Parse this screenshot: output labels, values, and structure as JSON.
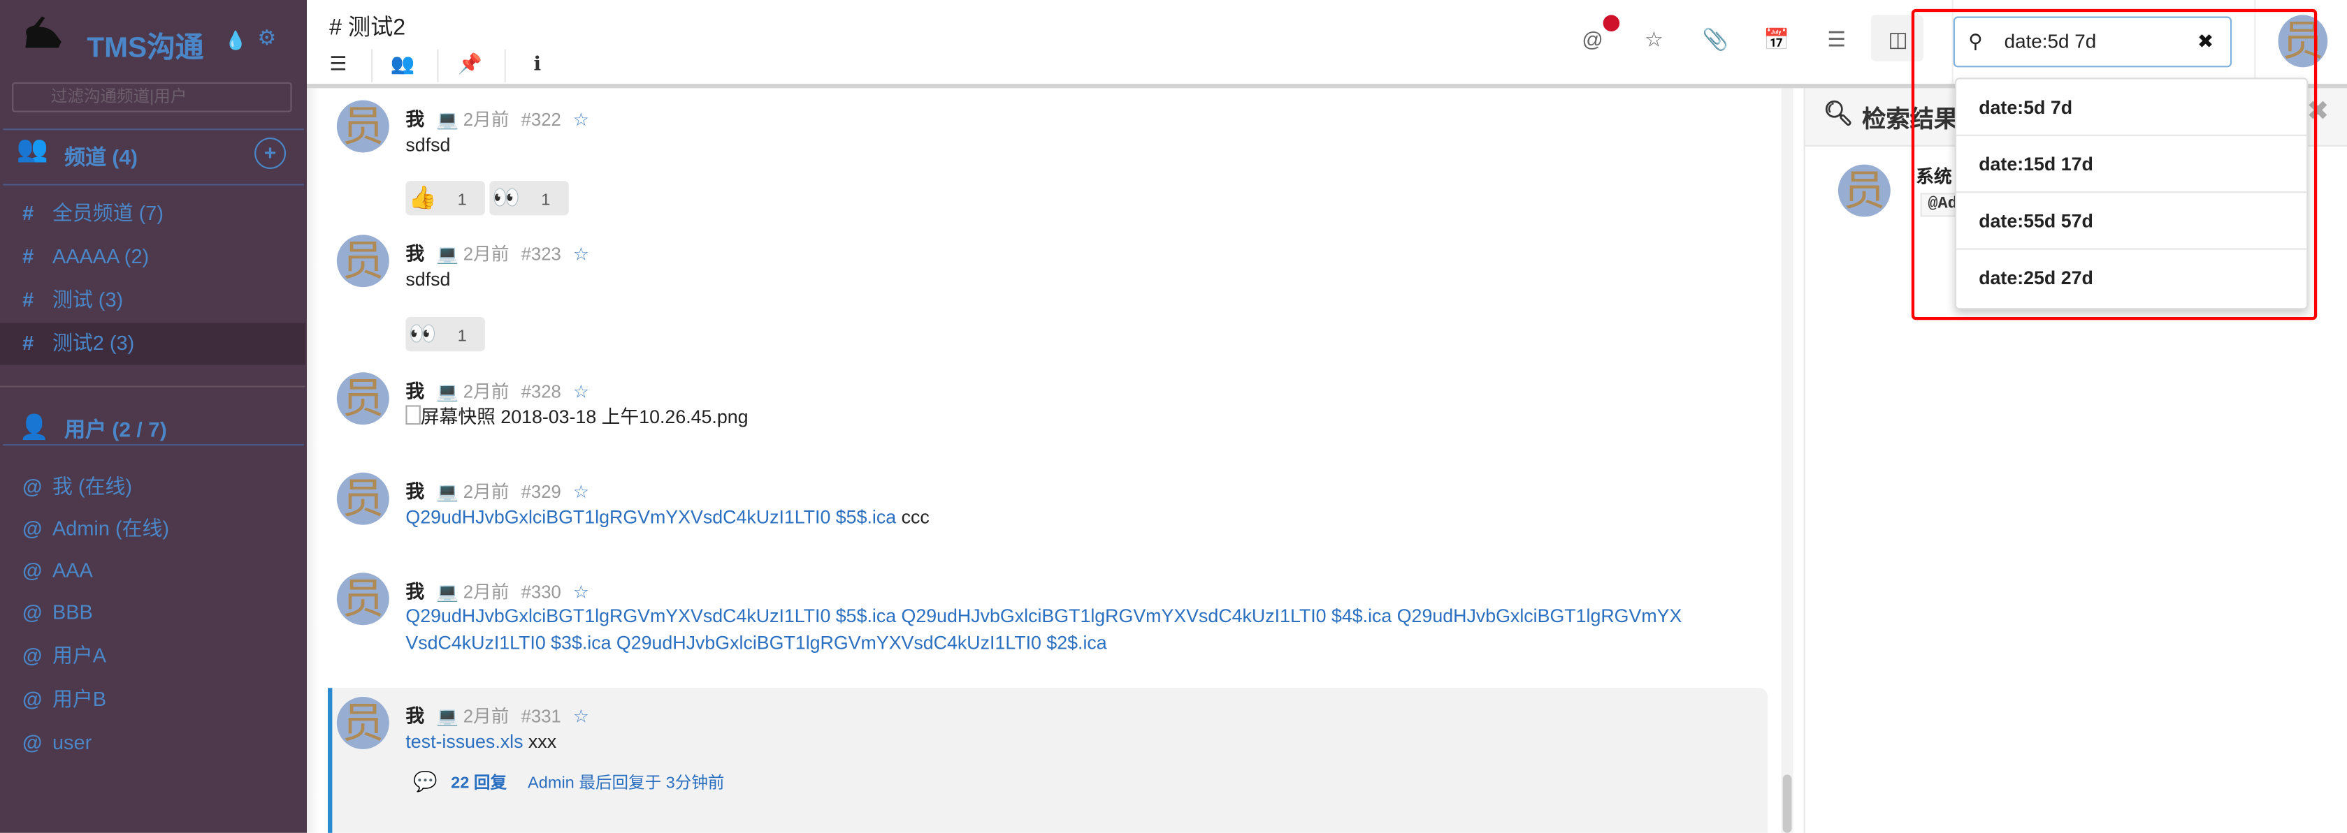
{
  "sidebar": {
    "app_title": "TMS沟通",
    "filter_placeholder": "过滤沟通频道|用户",
    "channels_header": "频道 (4)",
    "channels": [
      {
        "prefix": "#",
        "label": "全员频道 (7)"
      },
      {
        "prefix": "#",
        "label": "AAAAA (2)"
      },
      {
        "prefix": "#",
        "label": "测试 (3)"
      },
      {
        "prefix": "#",
        "label": "测试2 (3)",
        "active": true
      }
    ],
    "users_header": "用户 (2 / 7)",
    "users": [
      {
        "prefix": "@",
        "label": "我 (在线)"
      },
      {
        "prefix": "@",
        "label": "Admin (在线)"
      },
      {
        "prefix": "@",
        "label": "AAA"
      },
      {
        "prefix": "@",
        "label": "BBB"
      },
      {
        "prefix": "@",
        "label": "用户A"
      },
      {
        "prefix": "@",
        "label": "用户B"
      },
      {
        "prefix": "@",
        "label": "user"
      }
    ]
  },
  "header": {
    "channel_title": "# 测试2",
    "search_value": "date:5d 7d",
    "notification_dot_color": "#d0112b"
  },
  "search_suggestions": [
    "date:5d 7d",
    "date:15d 17d",
    "date:55d 57d",
    "date:25d 27d"
  ],
  "avatar_glyph": "员",
  "messages": [
    {
      "author": "我",
      "time": "2月前",
      "id": "#322",
      "text": "sdfsd",
      "reactions": [
        {
          "emoji": "👍",
          "count": "1"
        },
        {
          "emoji": "👀",
          "count": "1"
        }
      ]
    },
    {
      "author": "我",
      "time": "2月前",
      "id": "#323",
      "text": "sdfsd",
      "reactions": [
        {
          "emoji": "👀",
          "count": "1"
        }
      ]
    },
    {
      "author": "我",
      "time": "2月前",
      "id": "#328",
      "text": "屏幕快照 2018-03-18 上午10.26.45.png"
    },
    {
      "author": "我",
      "time": "2月前",
      "id": "#329",
      "link": "Q29udHJvbGxlciBGT1lgRGVmYXVsdC4kUzI1LTI0 $5$.ica",
      "text": " ccc"
    },
    {
      "author": "我",
      "time": "2月前",
      "id": "#330",
      "link_line1": "Q29udHJvbGxlciBGT1lgRGVmYXVsdC4kUzI1LTI0 $5$.ica Q29udHJvbGxlciBGT1lgRGVmYXVsdC4kUzI1LTI0 $4$.ica Q29udHJvbGxlciBGT1lgRGVmYX",
      "link_line2": "VsdC4kUzI1LTI0 $3$.ica Q29udHJvbGxlciBGT1lgRGVmYXVsdC4kUzI1LTI0 $2$.ica"
    },
    {
      "author": "我",
      "time": "2月前",
      "id": "#331",
      "link": "test-issues.xls",
      "text": " xxx",
      "replies": "22 回复",
      "last_reply": "Admin 最后回复于 3分钟前"
    }
  ],
  "search_panel": {
    "title": "检索结果",
    "result_author": "系统",
    "result_snippet": "@Ad"
  }
}
